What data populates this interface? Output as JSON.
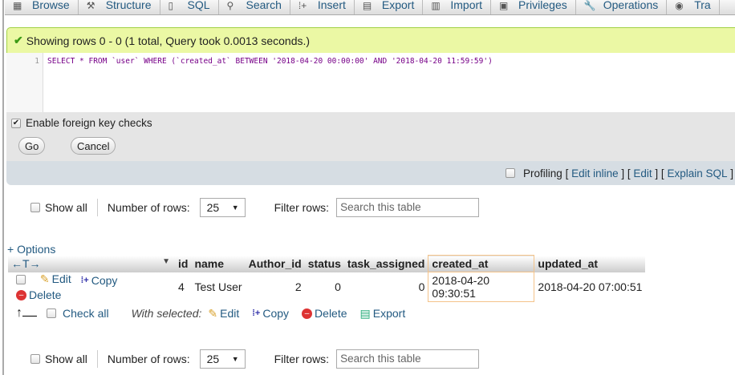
{
  "tabs": [
    {
      "label": "Browse",
      "icon": "browse-icon"
    },
    {
      "label": "Structure",
      "icon": "structure-icon"
    },
    {
      "label": "SQL",
      "icon": "sql-icon"
    },
    {
      "label": "Search",
      "icon": "search-icon"
    },
    {
      "label": "Insert",
      "icon": "insert-icon"
    },
    {
      "label": "Export",
      "icon": "export-icon"
    },
    {
      "label": "Import",
      "icon": "import-icon"
    },
    {
      "label": "Privileges",
      "icon": "privileges-icon"
    },
    {
      "label": "Operations",
      "icon": "operations-icon"
    },
    {
      "label": "Tra",
      "icon": "tracking-icon"
    }
  ],
  "message": "Showing rows 0 - 0 (1 total, Query took 0.0013 seconds.)",
  "sql": {
    "line": "1",
    "query": "SELECT * FROM `user` WHERE (`created_at` BETWEEN '2018-04-20 00:00:00' AND '2018-04-20 11:59:59')"
  },
  "options": {
    "fk_label": "Enable foreign key checks",
    "go": "Go",
    "cancel": "Cancel"
  },
  "profiling": {
    "label": "Profiling",
    "edit_inline": "Edit inline",
    "edit": "Edit",
    "explain": "Explain SQL"
  },
  "nav": {
    "show_all": "Show all",
    "rows_label": "Number of rows:",
    "rows_value": "25",
    "filter_label": "Filter rows:",
    "filter_placeholder": "Search this table"
  },
  "table": {
    "options": "+ Options",
    "columns": [
      "id",
      "name",
      "Author_id",
      "status",
      "task_assigned",
      "created_at",
      "updated_at"
    ],
    "rows": [
      {
        "id": "4",
        "name": "Test User",
        "author_id": "2",
        "status": "0",
        "task_assigned": "0",
        "created_at": "2018-04-20 09:30:51",
        "updated_at": "2018-04-20 07:00:51"
      }
    ],
    "row_actions": {
      "edit": "Edit",
      "copy": "Copy",
      "delete": "Delete"
    }
  },
  "bulk": {
    "check_all": "Check all",
    "with_selected": "With selected:",
    "edit": "Edit",
    "copy": "Copy",
    "delete": "Delete",
    "export": "Export"
  }
}
